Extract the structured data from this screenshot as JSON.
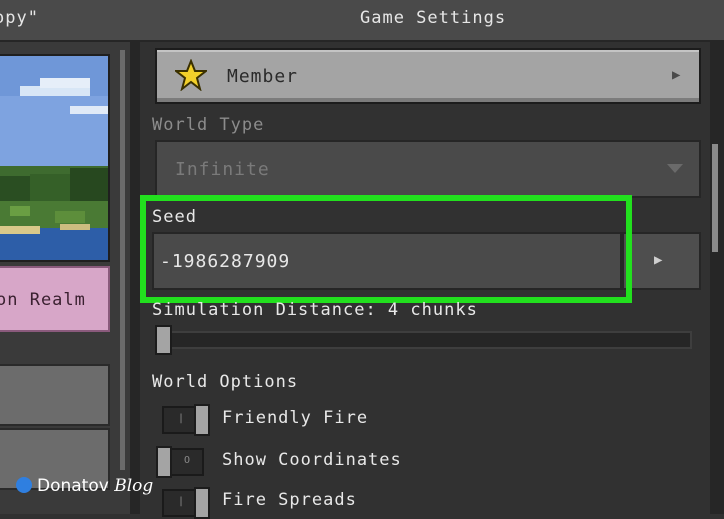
{
  "header": {
    "left_title": "opy\"",
    "center_title": "Game Settings"
  },
  "left": {
    "realm_button_label": "on Realm"
  },
  "permission": {
    "label": "Member"
  },
  "world_type": {
    "label": "World Type",
    "value": "Infinite"
  },
  "seed": {
    "label": "Seed",
    "value": "-1986287909"
  },
  "simulation": {
    "label": "Simulation Distance: 4 chunks",
    "level": 0
  },
  "world_options": {
    "label": "World Options",
    "items": [
      {
        "label": "Friendly Fire",
        "on": true
      },
      {
        "label": "Show Coordinates",
        "on": false
      },
      {
        "label": "Fire Spreads",
        "on": true
      }
    ],
    "off_mark": "O",
    "on_mark": "|"
  },
  "watermark": {
    "brand": "Donatov",
    "suffix": "Blog"
  },
  "colors": {
    "highlight": "#22e01e",
    "realm": "#d7a6c8",
    "button": "#a4a4a4"
  },
  "icons": {
    "member": "star-icon",
    "chevron": "chevron-right-icon",
    "dropdown": "caret-down-icon"
  }
}
